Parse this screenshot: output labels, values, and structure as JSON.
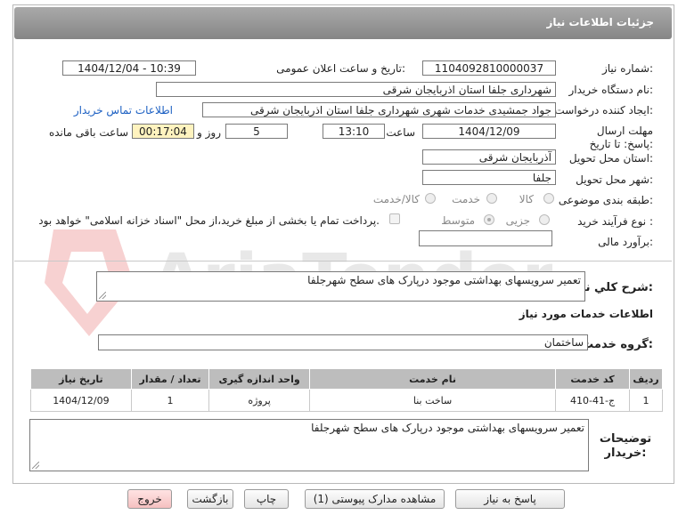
{
  "header": {
    "title": "جزئیات اطلاعات نیاز"
  },
  "form": {
    "need_number": {
      "label": "شماره نیاز:",
      "value": "1104092810000037"
    },
    "announce_datetime": {
      "label": "تاریخ و ساعت اعلان عمومی:",
      "value": "1404/12/04 - 10:39"
    },
    "buyer_org": {
      "label": "نام دستگاه خریدار:",
      "value": "شهرداری جلفا استان اذربایجان شرقی"
    },
    "requester": {
      "label": "ایجاد کننده درخواست:",
      "value": "جواد جمشیدی  خدمات شهری شهرداری جلفا استان اذربایجان شرقی"
    },
    "contact_link": "اطلاعات تماس خریدار",
    "deadline": {
      "label": "مهلت ارسال پاسخ: تا تاریخ:",
      "date": "1404/12/09",
      "time_label": "ساعت",
      "time": "13:10",
      "days": "5",
      "days_label": "روز و",
      "remaining": "00:17:04",
      "remaining_label": "ساعت باقی مانده"
    },
    "province": {
      "label": "استان محل تحویل:",
      "value": "آذربایجان شرقی"
    },
    "city": {
      "label": "شهر محل تحویل:",
      "value": "جلفا"
    },
    "category": {
      "label": "طبقه بندی موضوعی:",
      "options": [
        "کالا",
        "خدمت",
        "کالا/خدمت"
      ]
    },
    "process": {
      "label": "نوع فرآیند خرید :",
      "options": [
        "جزیی",
        "متوسط"
      ],
      "payment_note": "پرداخت تمام یا بخشی از مبلغ خرید،از محل \"اسناد خزانه اسلامی\" خواهد بود."
    },
    "estimate": {
      "label": "برآورد مالی:",
      "value": ""
    }
  },
  "summary": {
    "label": "شرح کلي نياز:",
    "value": "تعمیر سرویسهای بهداشتی موجود درپارک های سطح شهرجلفا"
  },
  "services": {
    "title": "اطلاعات خدمات مورد نیاز",
    "group_label": "گروه خدمت:",
    "group_value": "ساختمان",
    "columns": [
      "ردیف",
      "کد خدمت",
      "نام خدمت",
      "واحد اندازه گیری",
      "تعداد / مقدار",
      "تاریخ نیاز"
    ],
    "rows": [
      [
        "1",
        "ج-41-410",
        "ساخت بنا",
        "پروژه",
        "1",
        "1404/12/09"
      ]
    ]
  },
  "buyer_notes": {
    "label": "توضیحات خریدار:",
    "value": "تعمیر سرویسهای بهداشتی موجود درپارک های سطح شهرجلفا"
  },
  "buttons": {
    "reply": "پاسخ به نیاز",
    "attachments": "مشاهده مدارک پیوستی (1)",
    "print": "چاپ",
    "back": "بازگشت",
    "exit": "خروج"
  },
  "watermark": "AriaTender.neT",
  "colors": {
    "header": "#999999",
    "link": "#1b5fc2",
    "yellow_field": "#fff3bf",
    "table_header": "#bdbdbd"
  }
}
